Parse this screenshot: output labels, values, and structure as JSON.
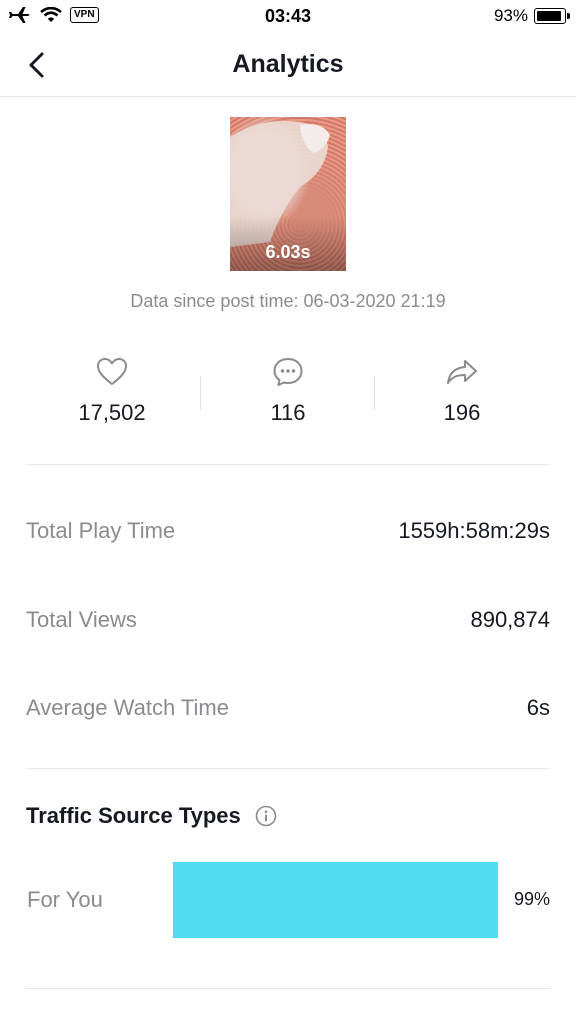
{
  "status_bar": {
    "vpn": "VPN",
    "time": "03:43",
    "battery": "93%",
    "battery_level": 0.93
  },
  "nav": {
    "title": "Analytics",
    "back_icon": "chevron-left-icon"
  },
  "video": {
    "duration": "6.03s"
  },
  "data_since": "Data since post time: 06-03-2020 21:19",
  "engagement": {
    "likes": "17,502",
    "comments": "116",
    "shares": "196",
    "icons": [
      "heart-icon",
      "comment-icon",
      "share-icon"
    ]
  },
  "metrics": [
    {
      "label": "Total Play Time",
      "value": "1559h:58m:29s"
    },
    {
      "label": "Total Views",
      "value": "890,874"
    },
    {
      "label": "Average Watch Time",
      "value": "6s"
    }
  ],
  "traffic": {
    "title": "Traffic Source Types",
    "info_icon": "info-icon",
    "sources": [
      {
        "label": "For You",
        "percent_text": "99%",
        "percent": 99
      }
    ],
    "bar_color": "#4fdcee"
  }
}
